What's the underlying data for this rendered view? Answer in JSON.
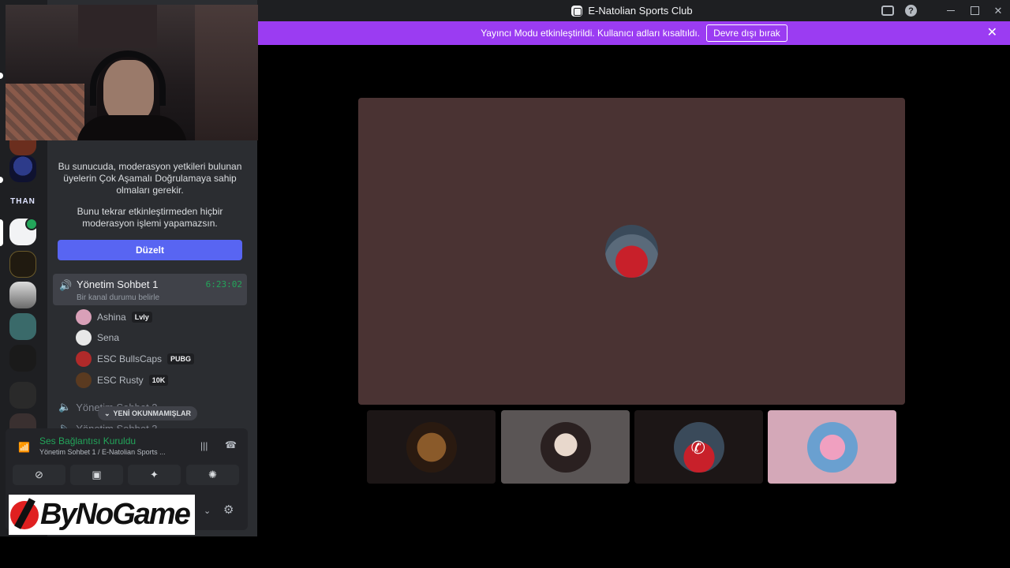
{
  "window": {
    "title": "E-Natolian Sports Club"
  },
  "notice": {
    "message": "Yayıncı Modu etkinleştirildi. Kullanıcı adları kısaltıldı.",
    "button": "Devre dışı bırak",
    "close": "✕"
  },
  "rail": {
    "servers": [
      {
        "name": "THAN",
        "label": "THAN"
      }
    ]
  },
  "mfa": {
    "text1": "Bu sunucuda, moderasyon yetkileri bulunan üyelerin Çok Aşamalı Doğrulamaya sahip olmaları gerekir.",
    "text2": "Bunu tekrar etkinleştirmeden hiçbir moderasyon işlemi yapamazsın.",
    "button": "Düzelt"
  },
  "voice_channel": {
    "name": "Yönetim Sohbet 1",
    "timer": "6:23:02",
    "status_placeholder": "Bir kanal durumu belirle",
    "members": [
      {
        "name": "Ashina",
        "tag": "Lvly"
      },
      {
        "name": "Sena",
        "tag": ""
      },
      {
        "name": "ESC BullsCaps",
        "tag": "PUBG"
      },
      {
        "name": "ESC Rusty",
        "tag": "10K"
      }
    ]
  },
  "other_channels": [
    {
      "name": "Yönetim Sohbet 2"
    },
    {
      "name": "Yönetim Sohbet 3"
    }
  ],
  "unread_pill": "YENİ OKUNMAMIŞLAR",
  "voice_panel": {
    "title": "Ses Bağlantısı Kuruldu",
    "subtitle": "Yönetim Sohbet 1 / E-Natolian Sports ..."
  },
  "logo": {
    "text": "ByNoGame"
  },
  "colors": {
    "notice_bg": "#9b3cf2",
    "accent": "#5865f2",
    "connected": "#23a55a",
    "stage_main": "#4a3333"
  }
}
